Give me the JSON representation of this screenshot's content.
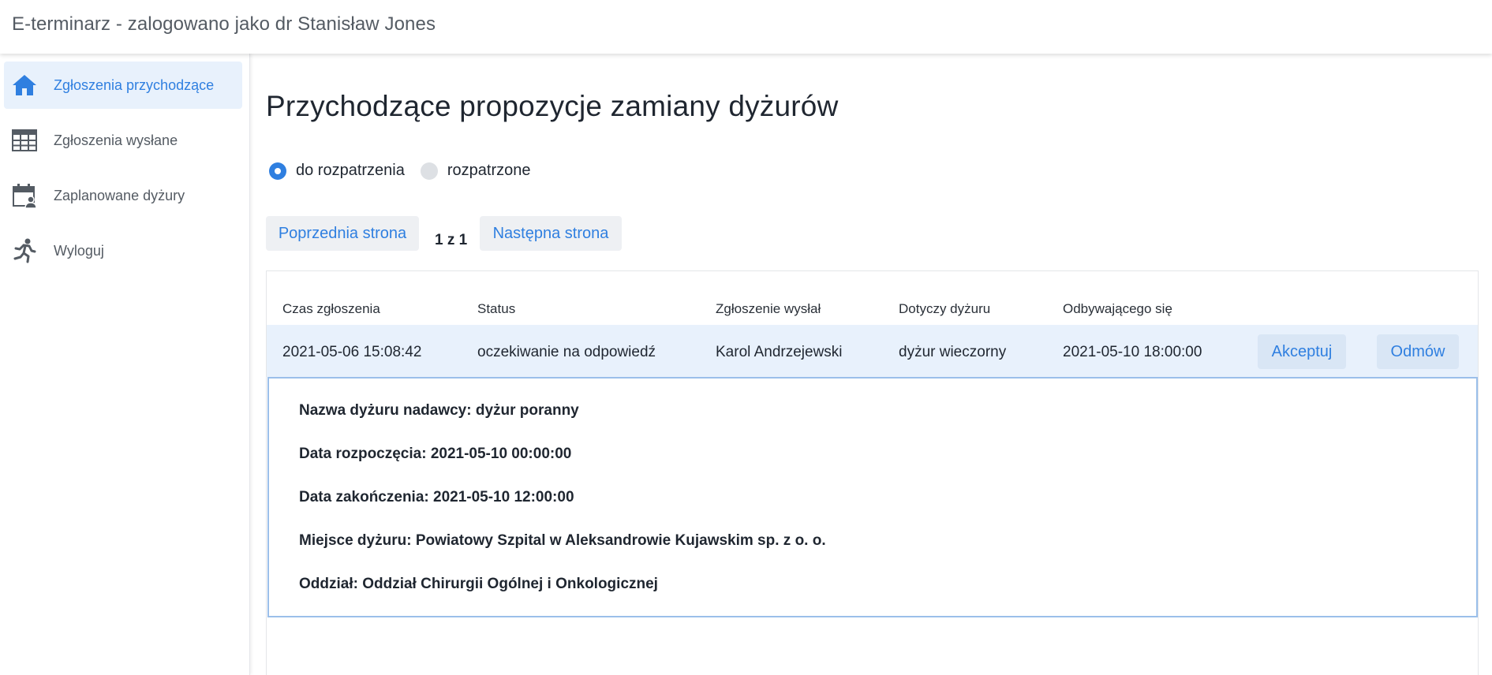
{
  "app": {
    "title": "E-terminarz - zalogowano jako dr Stanisław Jones"
  },
  "colors": {
    "accent": "#2f7fe0",
    "active_bg": "#e8f1fc",
    "button_bg": "#eef0f3",
    "detail_border": "#9bbfea"
  },
  "sidebar": {
    "items": [
      {
        "label": "Zgłoszenia przychodzące",
        "icon": "home-icon",
        "active": true
      },
      {
        "label": "Zgłoszenia wysłane",
        "icon": "table-icon",
        "active": false
      },
      {
        "label": "Zaplanowane dyżury",
        "icon": "calendar-user-icon",
        "active": false
      },
      {
        "label": "Wyloguj",
        "icon": "running-person-icon",
        "active": false
      }
    ]
  },
  "main": {
    "title": "Przychodzące propozycje zamiany dyżurów",
    "filter": {
      "options": [
        {
          "label": "do rozpatrzenia",
          "checked": true
        },
        {
          "label": "rozpatrzone",
          "checked": false
        }
      ]
    },
    "pagination": {
      "prev_label": "Poprzednia strona",
      "page_text": "1 z 1",
      "next_label": "Następna strona"
    },
    "table": {
      "headers": [
        "Czas zgłoszenia",
        "Status",
        "Zgłoszenie wysłał",
        "Dotyczy dyżuru",
        "Odbywającego się"
      ],
      "rows": [
        {
          "cells": [
            "2021-05-06 15:08:42",
            "oczekiwanie na odpowiedź",
            "Karol Andrzejewski",
            "dyżur wieczorny",
            "2021-05-10 18:00:00"
          ],
          "accept_label": "Akceptuj",
          "reject_label": "Odmów"
        }
      ]
    },
    "details": {
      "lines": [
        "Nazwa dyżuru nadawcy: dyżur poranny",
        "Data rozpoczęcia: 2021-05-10 00:00:00",
        "Data zakończenia: 2021-05-10 12:00:00",
        "Miejsce dyżuru: Powiatowy Szpital w Aleksandrowie Kujawskim sp. z o. o.",
        "Oddział: Oddział Chirurgii Ogólnej i Onkologicznej"
      ]
    }
  }
}
